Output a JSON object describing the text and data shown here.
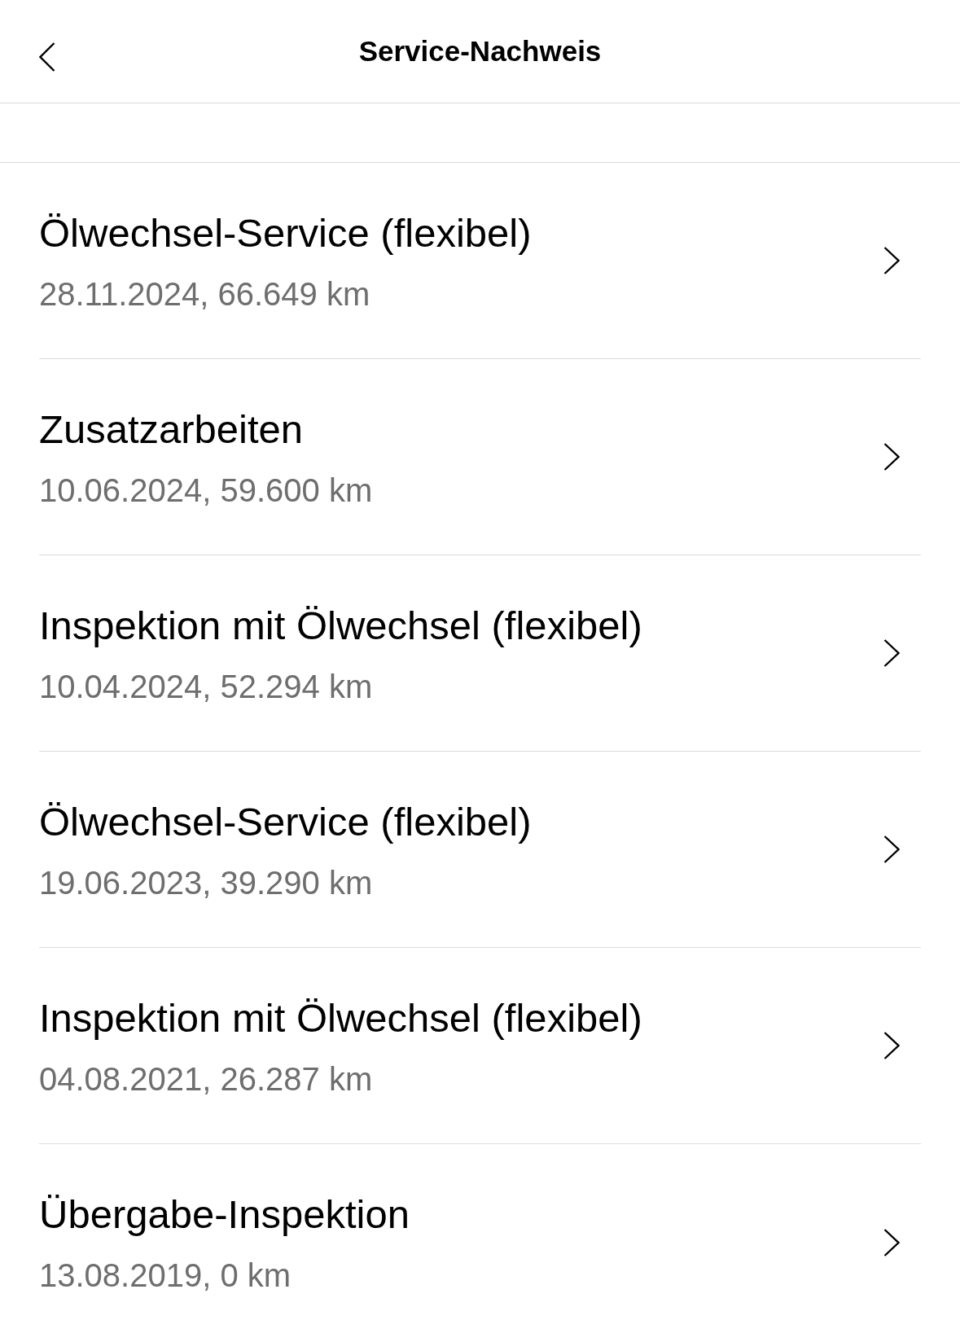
{
  "header": {
    "title": "Service-Nachweis"
  },
  "services": [
    {
      "title": "Ölwechsel-Service (flexibel)",
      "details": "28.11.2024, 66.649 km"
    },
    {
      "title": "Zusatzarbeiten",
      "details": "10.06.2024, 59.600 km"
    },
    {
      "title": "Inspektion mit Ölwechsel (flexibel)",
      "details": "10.04.2024, 52.294 km"
    },
    {
      "title": "Ölwechsel-Service (flexibel)",
      "details": "19.06.2023, 39.290 km"
    },
    {
      "title": "Inspektion mit Ölwechsel (flexibel)",
      "details": "04.08.2021, 26.287 km"
    },
    {
      "title": "Übergabe-Inspektion",
      "details": "13.08.2019, 0 km"
    }
  ]
}
